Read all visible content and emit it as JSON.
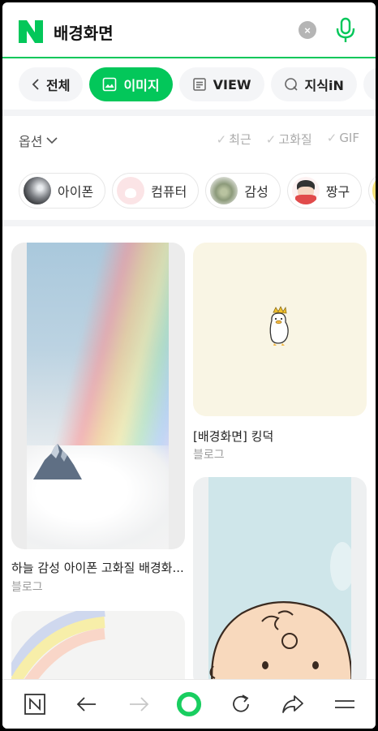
{
  "search": {
    "query": "배경화면",
    "clear_icon": "×"
  },
  "tabs": [
    {
      "label": "전체",
      "icon": "chevron-left-icon"
    },
    {
      "label": "이미지",
      "icon": "image-icon",
      "active": true
    },
    {
      "label": "VIEW",
      "icon": "document-icon"
    },
    {
      "label": "지식iN",
      "icon": "q-icon"
    },
    {
      "label": "",
      "icon": "person-icon"
    }
  ],
  "options": {
    "label": "옵션",
    "filters": [
      "최근",
      "고화질",
      "GIF"
    ]
  },
  "chips": [
    {
      "label": "아이폰"
    },
    {
      "label": "컴퓨터"
    },
    {
      "label": "감성"
    },
    {
      "label": "짱구"
    }
  ],
  "results": [
    {
      "title": "하늘 감성 아이폰 고화질 배경화...",
      "source": "블로그"
    },
    {
      "title": "[배경화면] 킹덕",
      "source": "블로그"
    }
  ],
  "colors": {
    "accent": "#03c75a"
  },
  "bottom_bar": [
    "naver-n-icon",
    "back-arrow-icon",
    "forward-arrow-icon",
    "home-green-icon",
    "refresh-icon",
    "share-icon",
    "menu-icon"
  ]
}
